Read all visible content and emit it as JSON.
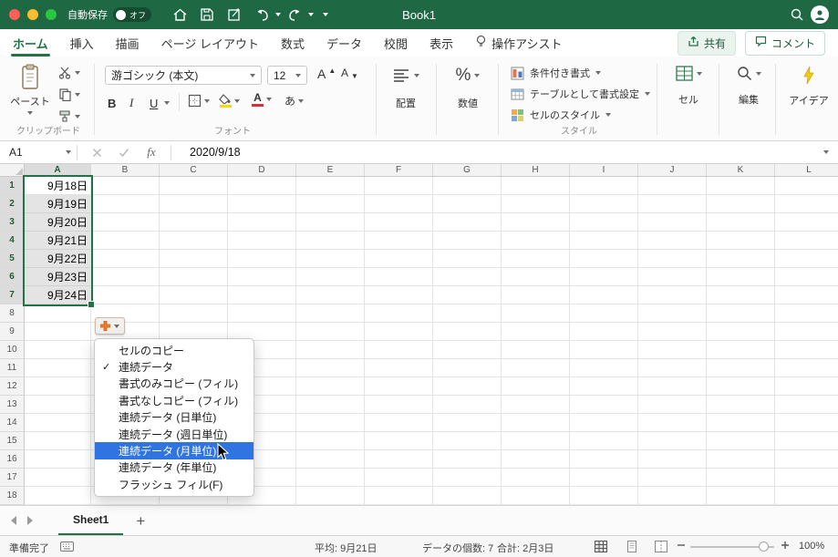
{
  "titlebar": {
    "autosave_label": "自動保存",
    "autosave_state": "オフ",
    "title": "Book1"
  },
  "ribbon_tabs": {
    "home": "ホーム",
    "insert": "挿入",
    "draw": "描画",
    "page_layout": "ページ レイアウト",
    "formulas": "数式",
    "data": "データ",
    "review": "校閲",
    "view": "表示",
    "tell_me": "操作アシスト",
    "share": "共有",
    "comments": "コメント"
  },
  "ribbon": {
    "paste": "ペースト",
    "clipboard_group": "クリップボード",
    "font_name": "游ゴシック (本文)",
    "font_size": "12",
    "grow_font_letter": "A",
    "shrink_font_letter": "A",
    "bold": "B",
    "italic": "I",
    "underline": "U",
    "font_color_letter": "A",
    "phonetic": "あ",
    "font_group": "フォント",
    "alignment": "配置",
    "number": "数値",
    "number_icon": "%",
    "conditional_formatting": "条件付き書式",
    "format_as_table": "テーブルとして書式設定",
    "cell_styles": "セルのスタイル",
    "styles_group": "スタイル",
    "cells": "セル",
    "editing": "編集",
    "ideas": "アイデア"
  },
  "formula_bar": {
    "name_box": "A1",
    "fx": "fx",
    "value": "2020/9/18"
  },
  "grid": {
    "columns": [
      "A",
      "B",
      "C",
      "D",
      "E",
      "F",
      "G",
      "H",
      "I",
      "J",
      "K",
      "L"
    ],
    "rows": [
      "1",
      "2",
      "3",
      "4",
      "5",
      "6",
      "7",
      "8",
      "9",
      "10",
      "11",
      "12",
      "13",
      "14",
      "15",
      "16",
      "17",
      "18"
    ],
    "dates": [
      "9月18日",
      "9月19日",
      "9月20日",
      "9月21日",
      "9月22日",
      "9月23日",
      "9月24日"
    ]
  },
  "fill_menu": {
    "check_glyph": "✓",
    "items": [
      "セルのコピー",
      "連続データ",
      "書式のみコピー (フィル)",
      "書式なしコピー (フィル)",
      "連続データ (日単位)",
      "連続データ (週日単位)",
      "連続データ (月単位)",
      "連続データ (年単位)",
      "フラッシュ フィル(F)"
    ],
    "checked_index": 1,
    "highlighted_index": 6
  },
  "sheet_bar": {
    "sheet1": "Sheet1"
  },
  "status_bar": {
    "ready": "準備完了",
    "average": "平均: 9月21日",
    "count": "データの個数: 7",
    "sum": "合計: 2月3日",
    "zoom": "100%"
  },
  "colors": {
    "titlebar_green": "#1E6843",
    "excel_green": "#217346",
    "selection_fill": "#E4E4E4",
    "menu_highlight": "#2F74E0",
    "fill_icon_orange": "#ED7D31"
  }
}
